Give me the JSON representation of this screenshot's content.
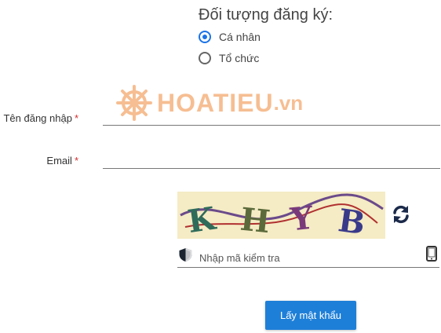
{
  "registration_type": {
    "title": "Đối tượng đăng ký:",
    "options": [
      {
        "label": "Cá nhân",
        "selected": true
      },
      {
        "label": "Tổ chức",
        "selected": false
      }
    ]
  },
  "watermark": {
    "brand": "HOATIEU",
    "suffix": ".vn"
  },
  "fields": {
    "username": {
      "label": "Tên đăng nhập",
      "required_mark": "*",
      "value": ""
    },
    "email": {
      "label": "Email",
      "required_mark": "*",
      "value": ""
    }
  },
  "captcha": {
    "text": "KHYB",
    "placeholder": "Nhập mã kiểm tra",
    "refresh_icon": "refresh-icon",
    "shield_icon": "shield-icon",
    "phone_icon": "mobile-phone-icon"
  },
  "submit": {
    "label": "Lấy mật khẩu"
  },
  "colors": {
    "accent": "#1e7fd8",
    "radio": "#1a73e8",
    "required": "#d32f2f",
    "watermark": "#f08a3a",
    "captcha_bg": "#f5ebc4"
  }
}
